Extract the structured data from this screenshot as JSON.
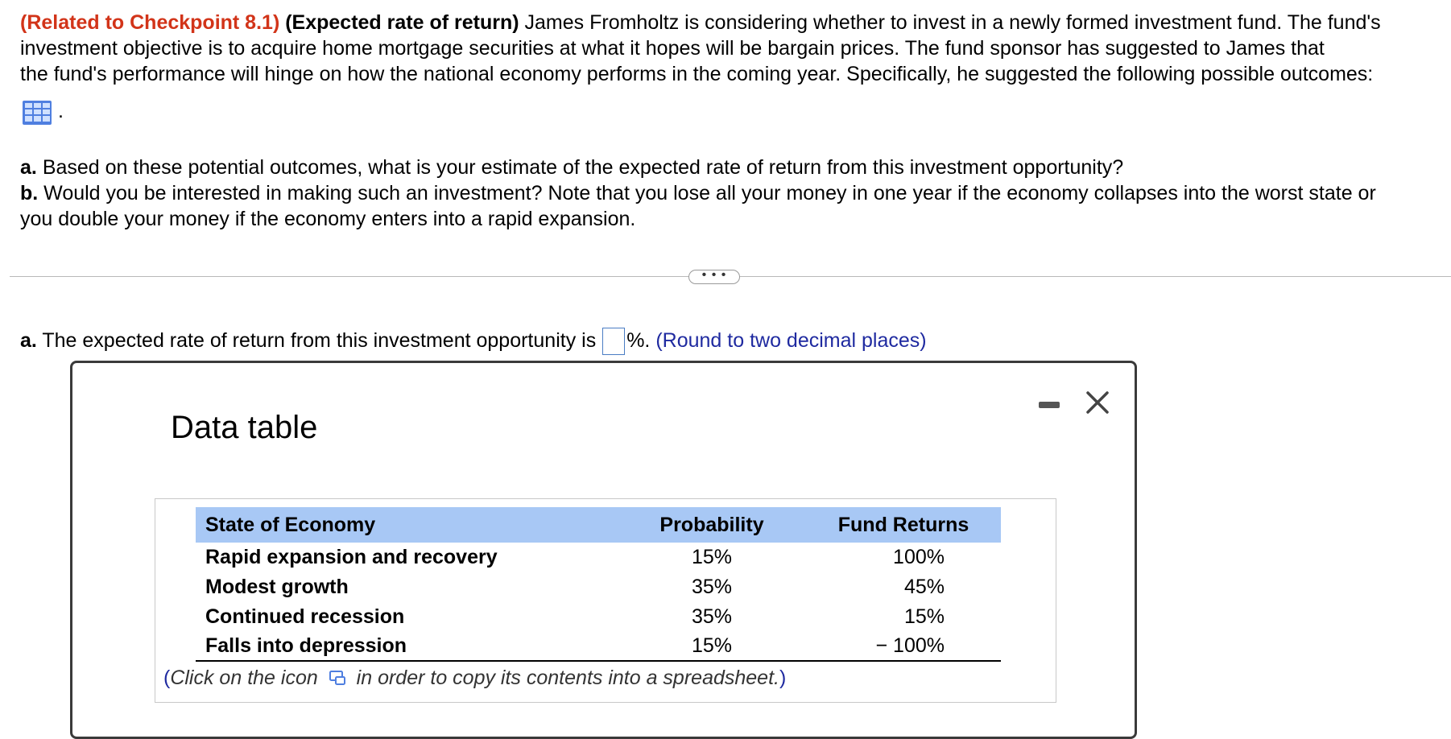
{
  "question": {
    "tag": "(Related to Checkpoint 8.1)",
    "topic": "(Expected rate of return)",
    "intro_line1": "James Fromholtz is considering whether to invest in a newly formed investment fund.  The fund's",
    "intro_line2": "investment objective is to acquire home mortgage securities at what it hopes will be bargain prices.  The fund sponsor has suggested to James that",
    "intro_line3": "the fund's performance will hinge on how the national economy performs in the coming year.  Specifically, he suggested the following possible outcomes:",
    "after_icon": ".",
    "part_a_label": "a.",
    "part_a_text": "Based on these potential outcomes, what is your estimate of the expected rate of return from this investment opportunity?",
    "part_b_label": "b.",
    "part_b_text_line1": "Would you be interested in making such an investment?  Note that you lose all your money in one year if the economy collapses into the worst state or",
    "part_b_text_line2": "you double your money if the economy enters into a rapid expansion."
  },
  "divider": {
    "more_label": "• • •"
  },
  "answer": {
    "label": "a.",
    "text": "The expected rate of return from this investment opportunity is",
    "value": "",
    "suffix": "%.",
    "hint": "(Round to two decimal places)"
  },
  "modal": {
    "title": "Data table",
    "table": {
      "headers": [
        "State of Economy",
        "Probability",
        "Fund Returns"
      ],
      "rows": [
        [
          "Rapid expansion and recovery",
          "15%",
          "100%"
        ],
        [
          "Modest growth",
          "35%",
          "45%"
        ],
        [
          "Continued recession",
          "35%",
          "15%"
        ],
        [
          "Falls into depression",
          "15%",
          "− 100%"
        ]
      ]
    },
    "caption_open": "(",
    "caption_before": "Click on the icon",
    "caption_after": "in order to copy its contents into a spreadsheet.",
    "caption_close": ")"
  },
  "icons": {
    "data_table": "grid-table-icon",
    "copy": "copy-spreadsheet-icon",
    "minimize": "minimize-icon",
    "close": "close-icon"
  }
}
